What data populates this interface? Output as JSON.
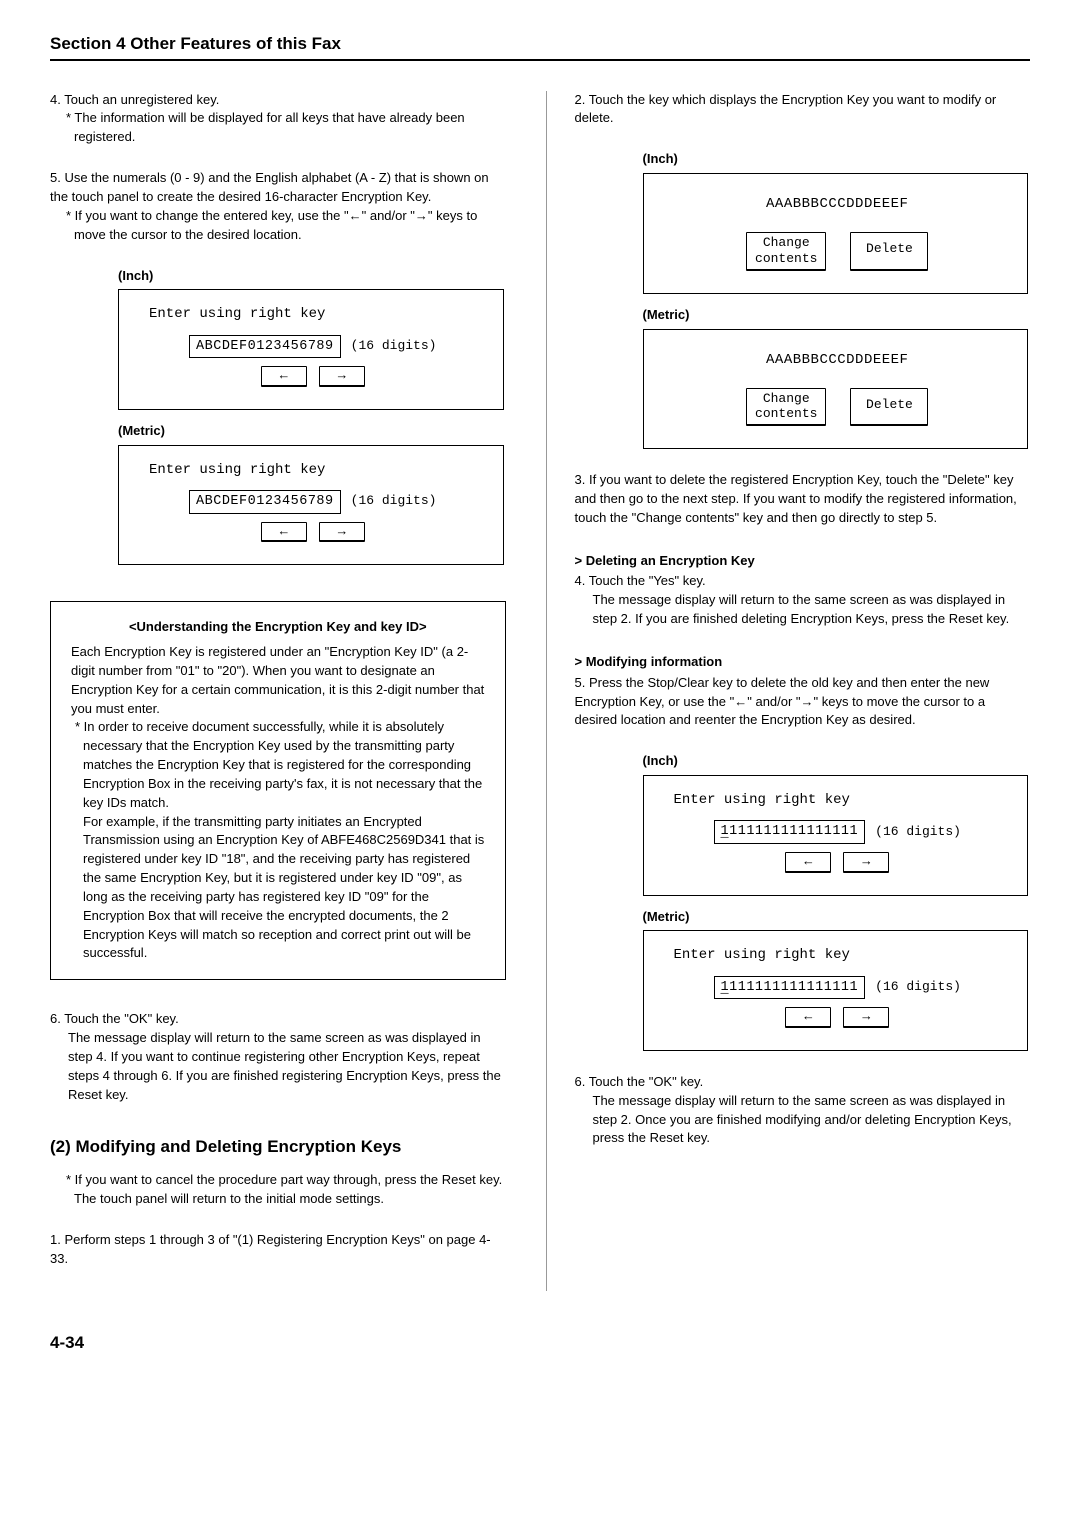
{
  "section_title": "Section 4 Other Features of this Fax",
  "left": {
    "step4": "4. Touch an unregistered key.",
    "step4_note": "* The information will be displayed for all keys that have already been registered.",
    "step5": "5. Use the numerals (0 - 9) and the English alphabet (A - Z) that is shown on the touch panel to create the desired 16-character Encryption Key.",
    "step5_note": "* If you want to change the entered key, use the \"←\" and/or \"→\" keys to move the cursor to the desired location.",
    "inch_label": "(Inch)",
    "metric_label": "(Metric)",
    "lcd_prompt": "Enter using right key",
    "lcd_value": "ABCDEF0123456789",
    "lcd_hint": "(16 digits)",
    "arrow_left": "←",
    "arrow_right": "→",
    "info_title": "<Understanding the Encryption Key and key ID>",
    "info_p1": "Each Encryption Key is registered under an \"Encryption Key ID\" (a 2-digit number from \"01\" to \"20\"). When you want to designate an Encryption Key for a certain communication, it is this 2-digit number that you must enter.",
    "info_p2": "* In order to receive document successfully, while it is absolutely necessary that the Encryption Key used by the transmitting party matches the Encryption Key that is registered for the corresponding Encryption Box in the receiving party's fax, it is not necessary that the key IDs match.",
    "info_p3": "For example, if the transmitting party initiates an Encrypted Transmission using an Encryption Key of ABFE468C2569D341 that is registered under key ID \"18\", and the receiving party has registered the same Encryption Key, but it is registered under key ID \"09\", as long as the receiving party has registered key ID \"09\" for the Encryption Box that will receive the encrypted documents, the 2 Encryption Keys will match so reception and correct print out will be successful.",
    "step6": "6. Touch the \"OK\" key.",
    "step6_body": "The message display will return to the same screen as was displayed in step 4. If you want to continue registering other Encryption Keys, repeat steps 4 through 6. If you are finished registering Encryption Keys, press the Reset key.",
    "sub_heading": "(2) Modifying and Deleting Encryption Keys",
    "cancel_note": "* If you want to cancel the procedure part way through, press the Reset key. The touch panel will return to the initial mode settings.",
    "step1": "1. Perform steps 1 through 3 of \"(1) Registering Encryption Keys\" on page 4-33."
  },
  "right": {
    "step2": "2. Touch the key which displays the Encryption Key you want to modify or delete.",
    "inch_label": "(Inch)",
    "metric_label": "(Metric)",
    "lcd_code": "AAABBBCCCDDDEEEF",
    "btn_change": "Change\ncontents",
    "btn_delete": "Delete",
    "step3": "3. If you want to delete the registered Encryption Key, touch the \"Delete\" key and then go to the next step. If you want to modify the registered information, touch the \"Change contents\" key and then go directly to step 5.",
    "del_head": "> Deleting an Encryption Key",
    "step4": "4. Touch the \"Yes\" key.",
    "step4_body": "The message display will return to the same screen as was displayed in step 2. If you are finished deleting Encryption Keys, press the Reset key.",
    "mod_head": "> Modifying information",
    "step5": "5. Press the Stop/Clear key to delete the old key and then enter the new Encryption Key, or use the \"←\" and/or \"→\" keys to move the cursor to a desired location and reenter the Encryption Key as desired.",
    "lcd_prompt": "Enter using right key",
    "lcd_value2": "1111111111111111",
    "lcd_hint": "(16 digits)",
    "step6": "6. Touch the \"OK\" key.",
    "step6_body": "The message display will return to the same screen as was displayed in step 2. Once you are finished modifying and/or deleting Encryption Keys, press the Reset key."
  },
  "page_number": "4-34"
}
